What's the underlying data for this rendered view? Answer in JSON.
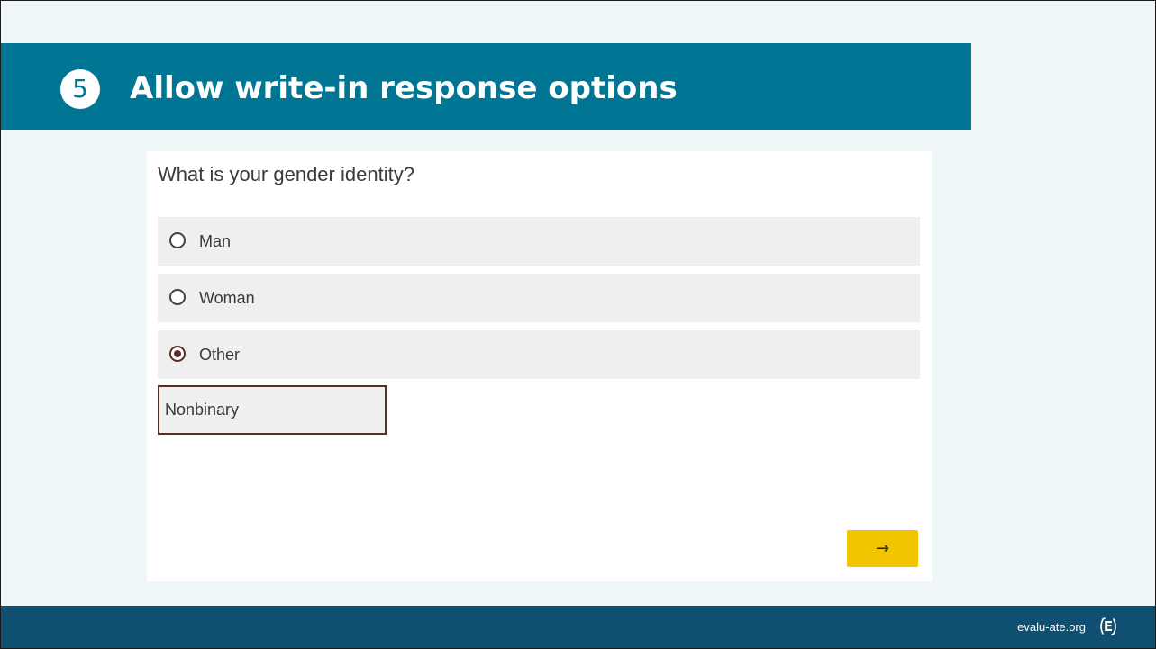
{
  "slide": {
    "step_number": "5",
    "title": "Allow write-in response options"
  },
  "survey": {
    "question": "What is your gender identity?",
    "options": [
      {
        "label": "Man",
        "selected": false
      },
      {
        "label": "Woman",
        "selected": false
      },
      {
        "label": "Other",
        "selected": true
      }
    ],
    "write_in": {
      "value": "Nonbinary",
      "placeholder": ""
    },
    "next_label": "→"
  },
  "footer": {
    "site": "evalu-ate.org",
    "logo_letter": "E"
  },
  "colors": {
    "banner": "#007694",
    "footer": "#0e4f72",
    "background": "#eef6f8",
    "next_button": "#f2c500",
    "selected_accent": "#5a2e22"
  },
  "icons": {
    "radio_unchecked": "radio-unchecked-icon",
    "radio_checked": "radio-checked-icon",
    "logo": "evaluate-logo-icon"
  }
}
